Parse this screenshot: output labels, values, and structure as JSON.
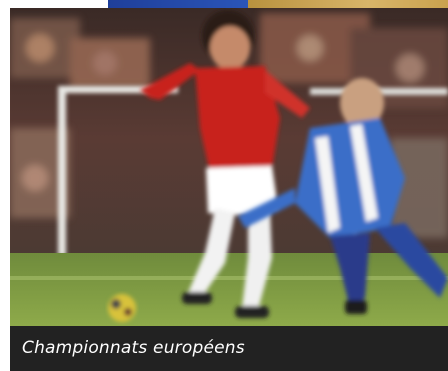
{
  "caption": "Championnats européens",
  "colors": {
    "caption_bar": "#222222",
    "caption_text": "#ffffff",
    "accent_blue": "#1f3f9a",
    "accent_gold": "#c9a24e"
  },
  "photo": {
    "icon": "football-match-photo"
  }
}
